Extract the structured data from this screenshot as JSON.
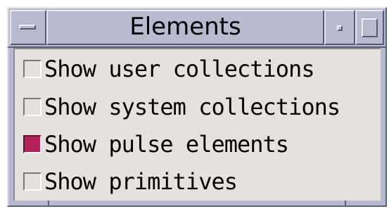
{
  "window": {
    "title": "Elements",
    "icons": {
      "menu": "window-menu-icon",
      "minimize": "minimize-icon",
      "maximize": "maximize-icon"
    }
  },
  "options": [
    {
      "label": "Show user collections",
      "checked": false
    },
    {
      "label": "Show system collections",
      "checked": false
    },
    {
      "label": "Show pulse elements",
      "checked": true
    },
    {
      "label": "Show primitives",
      "checked": false
    }
  ],
  "colors": {
    "titlebar": "#b8bbcf",
    "content_bg": "#e5e1de",
    "checked_fill": "#b5225a"
  }
}
